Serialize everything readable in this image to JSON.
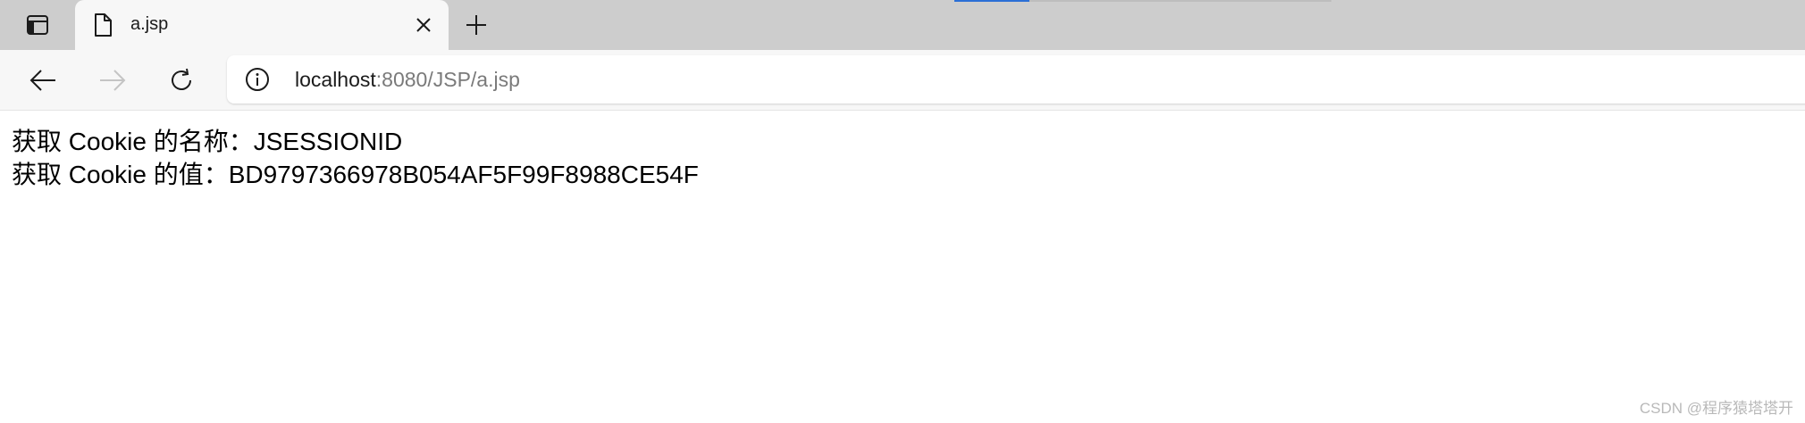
{
  "browser": {
    "tab": {
      "title": "a.jsp"
    },
    "address_bar": {
      "host": "localhost",
      "path": ":8080/JSP/a.jsp"
    }
  },
  "page": {
    "lines": [
      "获取 Cookie 的名称：JSESSIONID",
      "获取 Cookie 的值：BD9797366978B054AF5F99F8988CE54F"
    ]
  },
  "watermark": "CSDN @程序猿塔塔开",
  "colors": {
    "tabstrip_bg": "#cdcdcd",
    "active_tab_bg": "#f7f7f7",
    "loading_bar": "#2b6fd6"
  }
}
